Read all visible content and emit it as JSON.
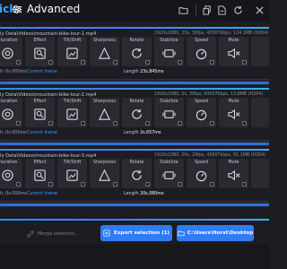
{
  "header": {
    "app_title_left": "ick",
    "app_title": "Advanced",
    "icons": [
      "folder-icon",
      "copy-icon",
      "file-icon",
      "reload-icon",
      "close-icon"
    ]
  },
  "effect_labels": {
    "saturation": "aturation",
    "effect": "Effect",
    "tilt_shift": "Tilt/Shift",
    "sharpness": "Sharpness",
    "rotate": "Rotate",
    "stabilize": "Stabilize",
    "speed": "Speed",
    "mute": "Mute"
  },
  "videos": [
    {
      "path": "ly Data\\Videos\\mountain-bike-tour-1.mp4",
      "meta": "1920x1080, 23s, 30fps, 43507kbps, 124.1MB (H264)",
      "start": "h: 0s:000ms",
      "current_frame": "Current frame",
      "length_label": "Length",
      "length_value": "23s,845ms"
    },
    {
      "path": "ly Data\\Videos\\mountain-bike-tour-2.mp4",
      "meta": "1920x1080, 2s, 30fps, 43507kbps, 13.8MB (H264)",
      "start": "h: 0s:000ms",
      "current_frame": "Current frame",
      "length_label": "Length",
      "length_value": "2s,657ms"
    },
    {
      "path": "ly Data\\Videos\\mountain-bike-tour-3.mp4",
      "meta": "1920x1080, 20s, 29fps, 43507kbps, 81.1MB (H264)",
      "start": "h: 0s:000ms",
      "current_frame": "Current frame",
      "length_label": "Length",
      "length_value": "20s,080ms"
    }
  ],
  "footer": {
    "merge_label": "Merge selection...",
    "export_label": "Export selection (1)",
    "folder_path": "C:\\Users\\Horst\\Desktop"
  },
  "colors": {
    "accent": "#2e7cf6",
    "link": "#3a9dff",
    "background": "#1c1c22",
    "tile": "#2a2a31"
  }
}
